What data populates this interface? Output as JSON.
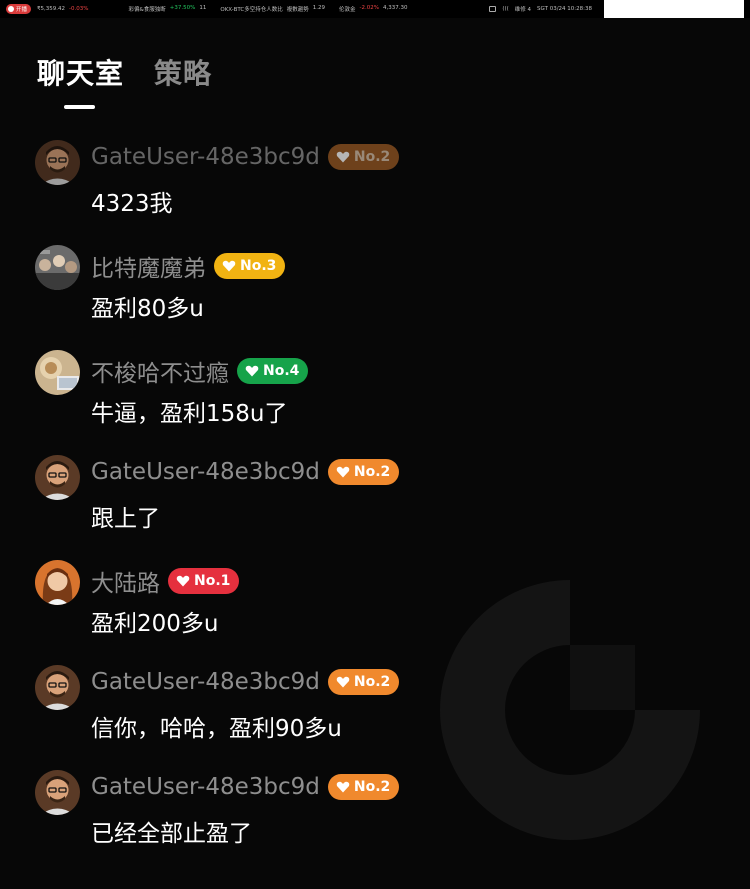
{
  "ticker": {
    "live_label": "开播",
    "items": [
      {
        "label": "₹5,359.42",
        "change": "-0.03%",
        "dir": "down"
      },
      {
        "label": "彩偏&食服独断",
        "change": "+37.50%",
        "extra": "11",
        "dir": "up"
      },
      {
        "label": "OKX-BTC多空持仓人数比",
        "extra2": "複數趨勢",
        "change": "1.29",
        "dir": "none"
      },
      {
        "label": "伦敦金",
        "change": "-2.02%",
        "extra": "4,337.30",
        "dir": "down"
      }
    ],
    "right": {
      "label": "维修 4",
      "wifi": "(((",
      "time": "SGT 03/24 10:28:38"
    }
  },
  "tabs": [
    {
      "label": "聊天室",
      "active": true
    },
    {
      "label": "策略",
      "active": false
    }
  ],
  "colors": {
    "background": "#070707",
    "badge_no1": "#e5303e",
    "badge_no2": "#f0892d",
    "badge_no3": "#f1b312",
    "badge_no4": "#16a34a"
  },
  "messages": [
    {
      "user": "GateUser-48e3bc9d",
      "badge": "No.2",
      "text": "4323我",
      "avatar": "man-glasses-avatar"
    },
    {
      "user": "比特魔魔弟",
      "badge": "No.3",
      "text": "盈利80多u",
      "avatar": "crowd-photo-avatar"
    },
    {
      "user": "不梭哈不过瘾",
      "badge": "No.4",
      "text": "牛逼，盈利158u了",
      "avatar": "food-photo-avatar"
    },
    {
      "user": "GateUser-48e3bc9d",
      "badge": "No.2",
      "text": "跟上了",
      "avatar": "man-glasses-avatar"
    },
    {
      "user": "大陆路",
      "badge": "No.1",
      "text": "盈利200多u",
      "avatar": "woman-avatar"
    },
    {
      "user": "GateUser-48e3bc9d",
      "badge": "No.2",
      "text": "信你，哈哈，盈利90多u",
      "avatar": "man-glasses-avatar"
    },
    {
      "user": "GateUser-48e3bc9d",
      "badge": "No.2",
      "text": "已经全部止盈了",
      "avatar": "man-glasses-avatar"
    }
  ]
}
